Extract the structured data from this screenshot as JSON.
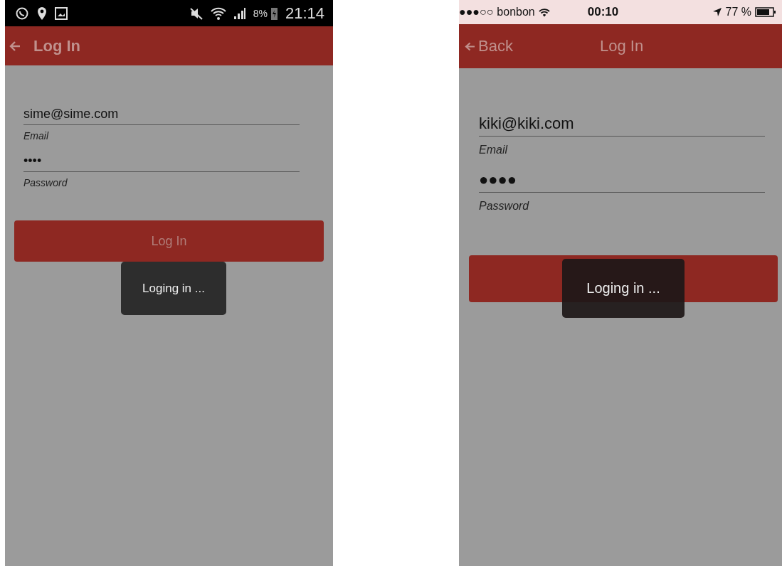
{
  "phones": [
    {
      "kind": "android",
      "status_bar": {
        "battery": "8%",
        "time": "21:14"
      },
      "header": {
        "title": "Log In"
      },
      "fields": [
        {
          "value": "sime@sime.com",
          "label": "Email"
        },
        {
          "value": "••••",
          "label": "Password"
        }
      ],
      "login_button": {
        "label": "Log In"
      },
      "toast": "Loging in ..."
    },
    {
      "kind": "ios",
      "status_bar": {
        "signal": "●●●○○",
        "carrier": "bonbon",
        "time": "00:10",
        "battery": "77 %"
      },
      "header": {
        "back": "Back",
        "title": "Log In"
      },
      "fields": [
        {
          "value": "kiki@kiki.com",
          "label": "Email"
        },
        {
          "value": "●●●●",
          "label": "Password"
        }
      ],
      "toast": "Loging in ..."
    }
  ]
}
